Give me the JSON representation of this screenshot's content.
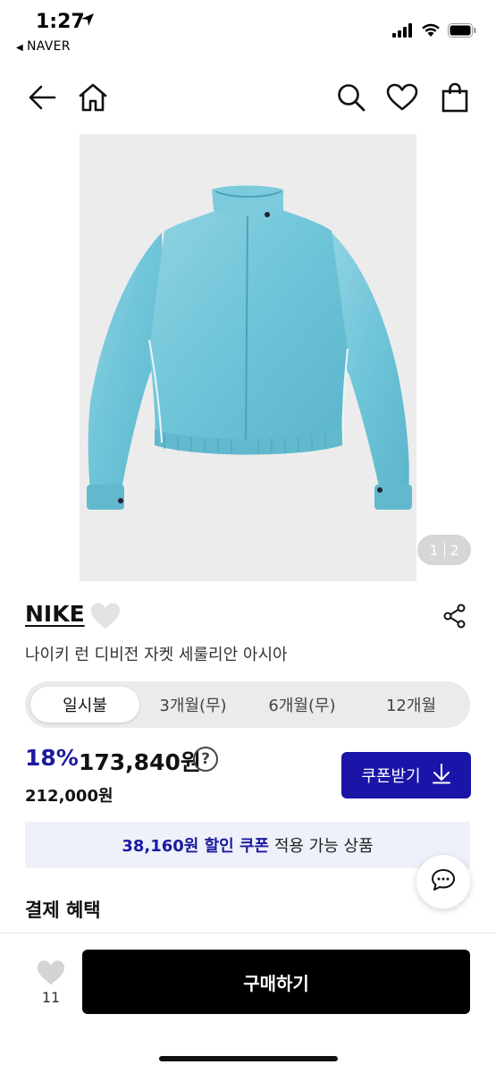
{
  "status_bar": {
    "time": "1:27",
    "back_app": "NAVER"
  },
  "nav": {
    "icons": [
      "back-arrow-icon",
      "home-icon",
      "search-icon",
      "heart-icon",
      "shopping-bag-icon"
    ]
  },
  "gallery": {
    "current": "1",
    "total": "2"
  },
  "product": {
    "brand": "NIKE",
    "name": "나이키 런 디비전 자켓 세룰리안 아시아"
  },
  "plan_tabs": [
    {
      "label": "일시불",
      "active": true
    },
    {
      "label": "3개월(무)",
      "active": false
    },
    {
      "label": "6개월(무)",
      "active": false
    },
    {
      "label": "12개월",
      "active": false
    }
  ],
  "pricing": {
    "discount": "18%",
    "price": "173,840원",
    "info_symbol": "?",
    "original_price": "212,000원"
  },
  "coupon": {
    "button_label": "쿠폰받기",
    "banner_highlight": "38,160원 할인 쿠폰",
    "banner_rest": " 적용 가능 상품"
  },
  "section": {
    "title": "결제 혜택"
  },
  "bottom_bar": {
    "like_count": "11",
    "buy_label": "구매하기"
  },
  "colors": {
    "accent": "#1c1a9e",
    "coupon_button": "#1a14a8",
    "banner_bg": "#eef1fa",
    "buy_button": "#000000"
  }
}
